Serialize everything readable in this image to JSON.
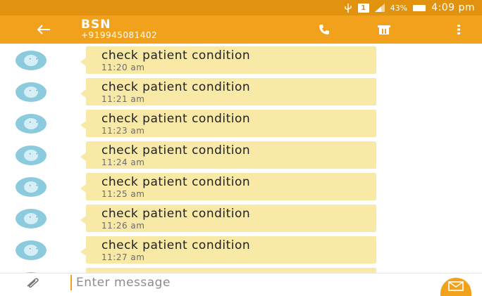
{
  "status_bar": {
    "sim_label": "1",
    "battery": "43%",
    "time": "4:09 pm"
  },
  "header": {
    "contact_name": "BSN",
    "contact_number": "+919945081402",
    "icons": [
      "back-arrow-icon",
      "phone-icon",
      "delete-icon",
      "more-vert-icon"
    ]
  },
  "messages": [
    {
      "text": "check patient condition",
      "time": "11:20 am"
    },
    {
      "text": "check patient condition",
      "time": "11:21 am"
    },
    {
      "text": "check patient condition",
      "time": "11:23 am"
    },
    {
      "text": "check patient condition",
      "time": "11:24 am"
    },
    {
      "text": "check patient condition",
      "time": "11:25 am"
    },
    {
      "text": "check patient condition",
      "time": "11:26 am"
    },
    {
      "text": "check patient condition",
      "time": "11:27 am"
    }
  ],
  "composer": {
    "placeholder": "Enter message",
    "icons": [
      "paperclip-icon",
      "send-icon"
    ]
  },
  "colors": {
    "status_bar": "#e1930f",
    "app_bar": "#f1a11c",
    "bubble": "#f8e9a6",
    "avatar": "#8ccbde"
  }
}
